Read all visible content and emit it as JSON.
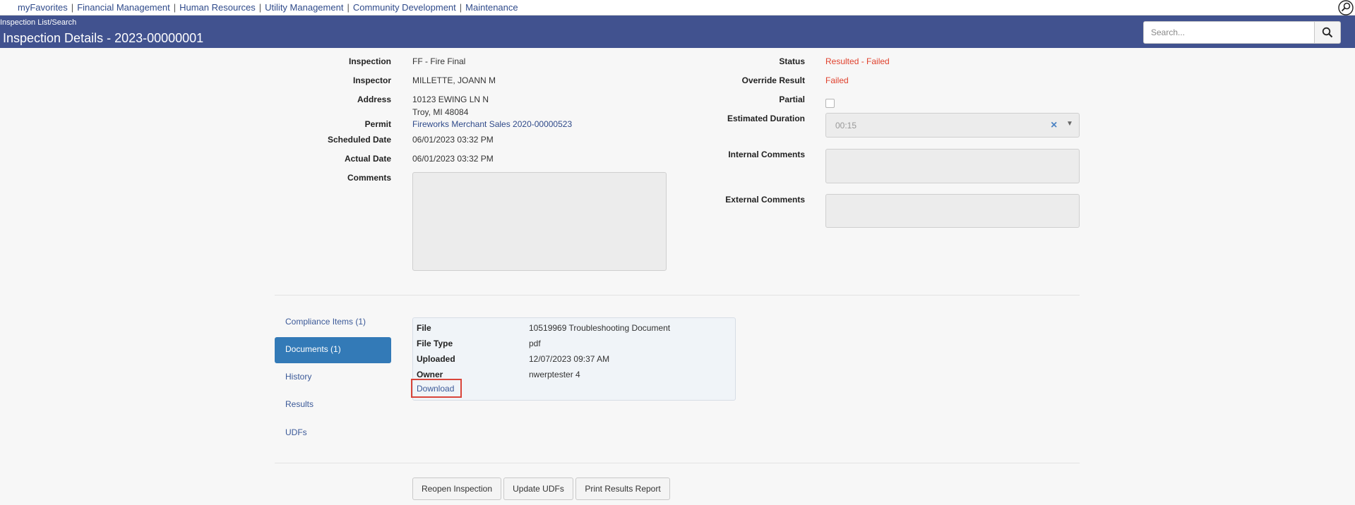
{
  "topnav": {
    "links": [
      "myFavorites",
      "Financial Management",
      "Human Resources",
      "Utility Management",
      "Community Development",
      "Maintenance"
    ],
    "separator": "|"
  },
  "header": {
    "breadcrumb": "Inspection List/Search",
    "title": "Inspection Details - 2023-00000001",
    "search_placeholder": "Search..."
  },
  "details": {
    "inspection": {
      "label": "Inspection",
      "value": "FF - Fire Final"
    },
    "inspector": {
      "label": "Inspector",
      "value": "MILLETTE, JOANN M"
    },
    "address": {
      "label": "Address",
      "line1": "10123 EWING LN N",
      "line2": "Troy, MI 48084"
    },
    "permit": {
      "label": "Permit",
      "value": "Fireworks Merchant Sales 2020-00000523"
    },
    "scheduled_date": {
      "label": "Scheduled Date",
      "value": "06/01/2023 03:32 PM"
    },
    "actual_date": {
      "label": "Actual Date",
      "value": "06/01/2023 03:32 PM"
    },
    "comments": {
      "label": "Comments",
      "value": ""
    },
    "status": {
      "label": "Status",
      "value": "Resulted - Failed"
    },
    "override_result": {
      "label": "Override Result",
      "value": "Failed"
    },
    "partial": {
      "label": "Partial",
      "checked": false
    },
    "estimated_duration": {
      "label": "Estimated Duration",
      "value": "00:15"
    },
    "internal_comments": {
      "label": "Internal Comments",
      "value": ""
    },
    "external_comments": {
      "label": "External Comments",
      "value": ""
    }
  },
  "tabs": [
    {
      "label": "Compliance Items (1)",
      "active": false
    },
    {
      "label": "Documents (1)",
      "active": true
    },
    {
      "label": "History",
      "active": false
    },
    {
      "label": "Results",
      "active": false
    },
    {
      "label": "UDFs",
      "active": false
    }
  ],
  "document": {
    "file_label": "File",
    "file": "10519969 Troubleshooting Document",
    "type_label": "File Type",
    "type": "pdf",
    "uploaded_label": "Uploaded",
    "uploaded": "12/07/2023 09:37 AM",
    "owner_label": "Owner",
    "owner": "nwerptester 4",
    "download_label": "Download"
  },
  "actions": {
    "reopen": "Reopen Inspection",
    "update_udfs": "Update UDFs",
    "print_report": "Print Results Report"
  },
  "colors": {
    "header_bg": "#41528f",
    "status_red": "#e0412d",
    "active_tab": "#337ab7",
    "link": "#2f4a8a",
    "highlight_border": "#d9453a"
  }
}
